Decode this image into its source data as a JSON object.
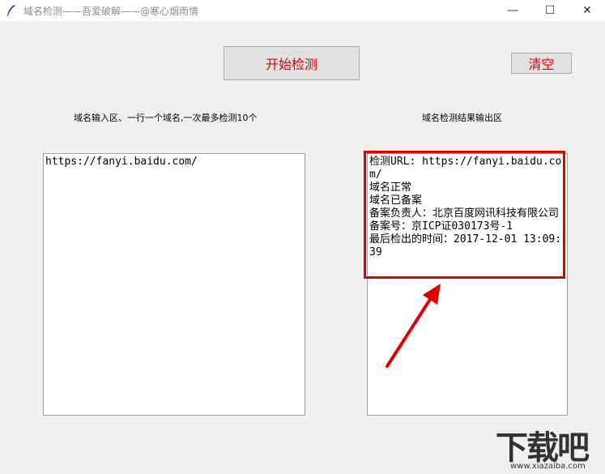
{
  "window": {
    "title": "域名检测——吾爱破解——@寒心烟雨情",
    "min_symbol": "—",
    "max_symbol": "☐",
    "close_symbol": "✕"
  },
  "toolbar": {
    "start_label": "开始检测",
    "clear_label": "清空"
  },
  "labels": {
    "input_label": "域名输入区、一行一个域名,一次最多检测10个",
    "output_label": "域名检测结果输出区"
  },
  "input": {
    "value": "https://fanyi.baidu.com/"
  },
  "output": {
    "lines": [
      "检测URL: https://fanyi.baidu.com/",
      "域名正常",
      "域名已备案",
      "备案负责人：北京百度网讯科技有限公司",
      "备案号：京ICP证030173号-1",
      "最后检出的时间：2017-12-01 13:09:39"
    ]
  },
  "watermark": {
    "text": "下载吧",
    "url": "www.xiazaiba.com"
  },
  "colors": {
    "accent": "#e00000",
    "background": "#f0f0f0"
  },
  "icons": {
    "app": "feather-icon"
  }
}
